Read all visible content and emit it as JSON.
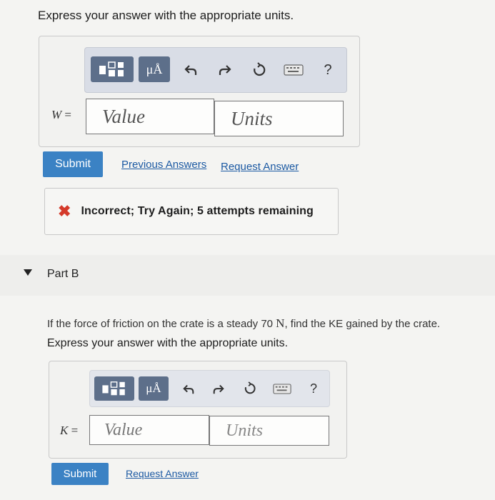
{
  "part_a": {
    "instruction": "Express your answer with the appropriate units.",
    "toolbar": {
      "mu_button": "μÅ",
      "help_label": "?"
    },
    "variable": "W",
    "equals": "=",
    "value_placeholder": "Value",
    "units_placeholder": "Units",
    "submit_label": "Submit",
    "previous_answers_label": "Previous Answers",
    "request_answer_label": "Request Answer",
    "feedback": {
      "icon": "x-icon",
      "text": "Incorrect; Try Again; 5 attempts remaining",
      "icon_color": "#d43a2a"
    }
  },
  "part_b": {
    "title": "Part B",
    "question_pre": "If the force of friction on the crate is a steady 70 ",
    "question_unit": "N",
    "question_post": ", find the KE gained by the crate.",
    "instruction": "Express your answer with the appropriate units.",
    "toolbar": {
      "mu_button": "μÅ",
      "help_label": "?"
    },
    "variable": "K",
    "equals": "=",
    "value_placeholder": "Value",
    "units_placeholder": "Units",
    "submit_label": "Submit",
    "request_answer_label": "Request Answer"
  },
  "colors": {
    "submit_bg": "#3b82c4",
    "link": "#1d5aa3",
    "toolbar_dark": "#5d6f8a"
  }
}
